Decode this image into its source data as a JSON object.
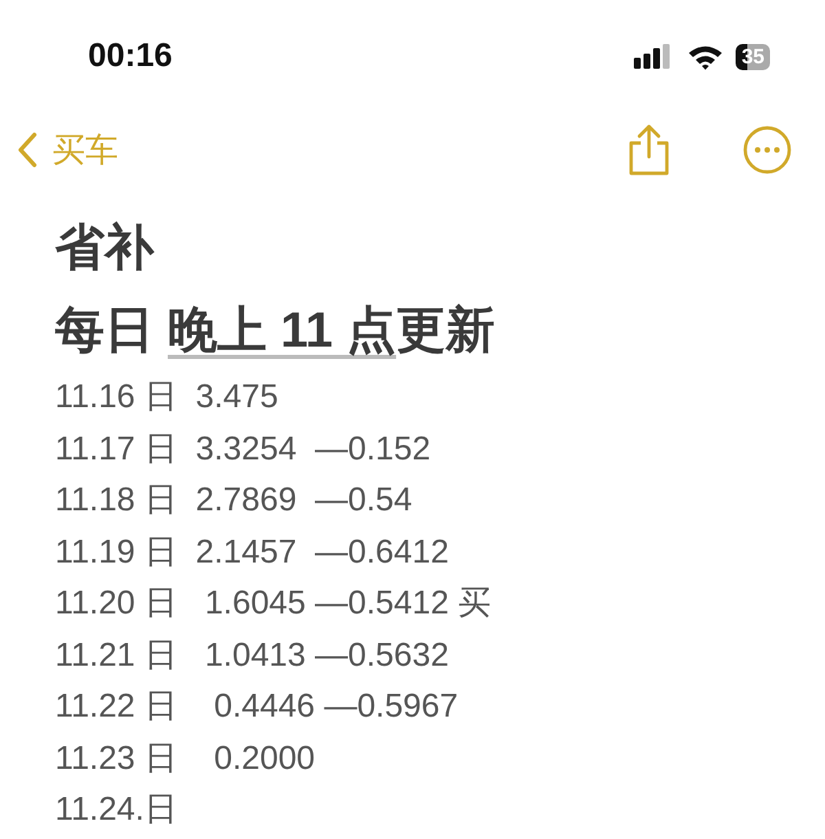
{
  "status_bar": {
    "time": "00:16",
    "battery": "35"
  },
  "nav": {
    "back_label": "买车"
  },
  "note": {
    "title": "省补",
    "subtitle": [
      {
        "text": "每日 ",
        "link": false
      },
      {
        "text": "晚上 11 点",
        "link": true
      },
      {
        "text": "更新",
        "link": false
      }
    ],
    "lines": [
      "11.16 日  3.475",
      "11.17 日  3.3254  —0.152",
      "11.18 日  2.7869  —0.54",
      "11.19 日  2.1457  —0.6412",
      "11.20 日   1.6045 —0.5412 买",
      "11.21 日   1.0413 —0.5632",
      "11.22 日    0.4446 —0.5967",
      "11.23 日    0.2000",
      "11.24.日"
    ]
  }
}
